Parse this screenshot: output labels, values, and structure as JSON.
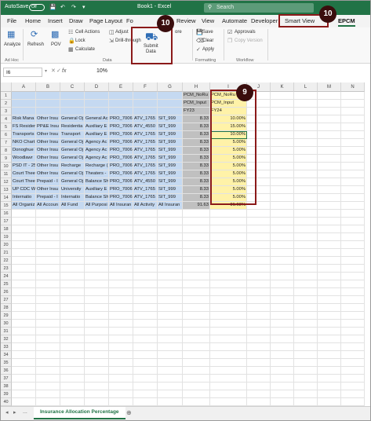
{
  "titlebar": {
    "autosave_label": "AutoSave",
    "toggle_state": "Off",
    "doc_title": "Book1 - Excel",
    "search_placeholder": "Search"
  },
  "menu": {
    "tabs": [
      "File",
      "Home",
      "Insert",
      "Draw",
      "Page Layout",
      "Fo",
      "Review",
      "View",
      "Automate",
      "Developer",
      "Smart View",
      "EPCM"
    ]
  },
  "ribbon": {
    "analyze": "Analyze",
    "refresh": "Refresh",
    "pov": "POV",
    "cell_actions": "Cell Actions",
    "lock": "Lock",
    "calculate": "Calculate",
    "adjust": "Adjust",
    "drill_through": "Drill-through",
    "submit_line1": "Submit",
    "submit_line2": "Data",
    "more": "ore",
    "save": "Save",
    "clear": "Clear",
    "apply": "Apply",
    "approvals": "Approvals",
    "copy_version": "Copy Version",
    "group_adhoc": "Ad Hoc",
    "group_data": "Data",
    "group_formatting": "Formatting",
    "group_workflow": "Workflow"
  },
  "formula_bar": {
    "name_box": "I6",
    "fx": "fx",
    "value": "10%"
  },
  "grid": {
    "columns": [
      "A",
      "B",
      "C",
      "D",
      "E",
      "F",
      "G",
      "H",
      "I",
      "J",
      "K",
      "L",
      "M",
      "N"
    ],
    "rows": [
      "1",
      "2",
      "3",
      "4",
      "5",
      "6",
      "7",
      "8",
      "9",
      "10",
      "11",
      "12",
      "13",
      "14",
      "15",
      "16",
      "17",
      "18",
      "19",
      "20",
      "21",
      "22",
      "23",
      "24",
      "25",
      "26",
      "27",
      "28",
      "29",
      "30",
      "31",
      "32",
      "33",
      "34",
      "35",
      "36",
      "37",
      "38",
      "39",
      "40"
    ],
    "header_cells": {
      "h1": "PCM_NoRu",
      "i1": "PCM_NoRu",
      "h2": "PCM_Input",
      "i2": "PCM_Input",
      "h3": "FY23",
      "i3": "FY24"
    },
    "data_rows": [
      {
        "a": "Risk Mana",
        "b": "Other Insu",
        "c": "General Oj",
        "d": "General Ac",
        "e": "PRO_7006",
        "f": "ATV_1765",
        "g": "SIT_999",
        "h": "8.33",
        "i": "10.00%"
      },
      {
        "a": "FS Residen",
        "b": "PP&E Insu",
        "c": "Residentia",
        "d": "Auxiliary E",
        "e": "PRO_7006",
        "f": "ATV_4550",
        "g": "SIT_999",
        "h": "8.33",
        "i": "15.00%"
      },
      {
        "a": "Transports",
        "b": "Other Insu",
        "c": "Transport",
        "d": "Auxiliary E",
        "e": "PRO_7006",
        "f": "ATV_1765",
        "g": "SIT_999",
        "h": "8.33",
        "i": "10.00%"
      },
      {
        "a": "NKO Chart",
        "b": "Other Insu",
        "c": "General Oj",
        "d": "Agency Ac",
        "e": "PRO_7006",
        "f": "ATV_1765",
        "g": "SIT_999",
        "h": "8.33",
        "i": "5.00%"
      },
      {
        "a": "Donoghue",
        "b": "Other Insu",
        "c": "General Oj",
        "d": "Agency Ac",
        "e": "PRO_7006",
        "f": "ATV_1765",
        "g": "SIT_999",
        "h": "8.33",
        "i": "5.00%"
      },
      {
        "a": "Woodlawr",
        "b": "Other Insu",
        "c": "General Oj",
        "d": "Agency Ac",
        "e": "PRO_7006",
        "f": "ATV_1765",
        "g": "SIT_999",
        "h": "8.33",
        "i": "5.00%"
      },
      {
        "a": "PSD IT - 25",
        "b": "Other Insu",
        "c": "Recharge",
        "d": "Recharge (",
        "e": "PRO_7006",
        "f": "ATV_1765",
        "g": "SIT_999",
        "h": "8.33",
        "i": "5.00%"
      },
      {
        "a": "Court Thee",
        "b": "Other Insu",
        "c": "General Oj",
        "d": "Theaters -",
        "e": "PRO_7006",
        "f": "ATV_1765",
        "g": "SIT_999",
        "h": "8.33",
        "i": "5.00%"
      },
      {
        "a": "Court Thee",
        "b": "Prepaid - I",
        "c": "General Oj",
        "d": "Balance Sh",
        "e": "PRO_7006",
        "f": "ATV_4550",
        "g": "SIT_999",
        "h": "8.33",
        "i": "5.00%"
      },
      {
        "a": "UP CDC W",
        "b": "Other Insu",
        "c": "University",
        "d": "Auxiliary E",
        "e": "PRO_7006",
        "f": "ATV_1765",
        "g": "SIT_999",
        "h": "8.33",
        "i": "5.00%"
      },
      {
        "a": "Internatio",
        "b": "Prepaid - I",
        "c": "Internatio",
        "d": "Balance Sh",
        "e": "PRO_7006",
        "f": "ATV_1765",
        "g": "SIT_999",
        "h": "8.33",
        "i": "5.00%"
      },
      {
        "a": "All Organiz",
        "b": "All Accoun",
        "c": "All Fund",
        "d": "All Purposi",
        "e": "All Insuran",
        "f": "All Activity",
        "g": "All Insuran",
        "h": "91.63",
        "i": "91.63%"
      }
    ]
  },
  "sheets": {
    "nav_prev": "◂",
    "nav_next": "▸",
    "more": "...",
    "active_tab": "Insurance Allocation Percentage",
    "add": "⊕"
  },
  "callouts": [
    {
      "label": "10"
    },
    {
      "label": "10"
    },
    {
      "label": "9"
    }
  ],
  "colors": {
    "excel_green": "#217346",
    "callout_border": "#8b1a1a",
    "selection_blue": "#c5d9f1",
    "input_yellow": "#fff2a8"
  }
}
